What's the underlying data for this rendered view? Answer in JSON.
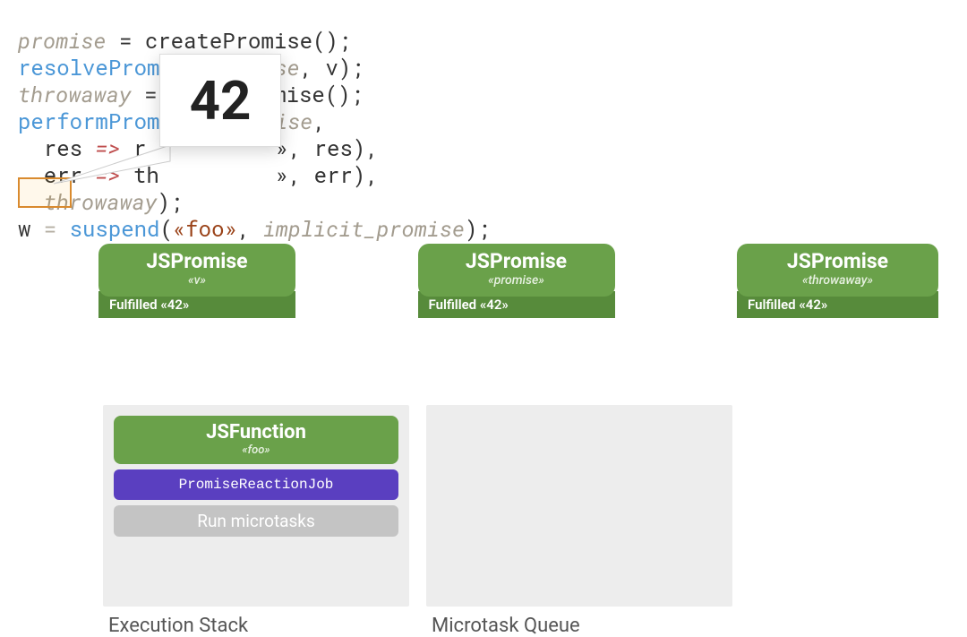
{
  "code": {
    "l1": {
      "a": "promise",
      "b": " = createPromise();"
    },
    "l2": {
      "a": "resolvePromise",
      "b": "(",
      "c": "promise",
      "d": ", v);"
    },
    "l3": {
      "a": "throwaway",
      "b": " =        omise();"
    },
    "l4": {
      "a": "performProm      ",
      "b": "romise",
      "c": ","
    },
    "l5": {
      "a": "  res ",
      "b": "=>",
      "c": " r          »",
      "d": ", res),",
      "d2": ""
    },
    "l6": {
      "a": "  err ",
      "b": "=>",
      "c": " th         »",
      "d": ", err),"
    },
    "l7": {
      "a": "  ",
      "b": "throwaway",
      "c": ");"
    },
    "l8": {
      "a": "w",
      "b": " = ",
      "c": "suspend",
      "d": "(",
      "e": "«foo»",
      "f": ", ",
      "g": "implicit_promise",
      "h": ");"
    }
  },
  "callout": {
    "value": "42"
  },
  "promises": [
    {
      "title": "JSPromise",
      "sub_l": "«",
      "sub": "v",
      "sub_r": "»",
      "status": "Fulfilled «42»"
    },
    {
      "title": "JSPromise",
      "sub_l": "«",
      "sub": "promise",
      "sub_r": "»",
      "status": "Fulfilled «42»"
    },
    {
      "title": "JSPromise",
      "sub_l": "«",
      "sub": "throwaway",
      "sub_r": "»",
      "status": "Fulfilled «42»"
    }
  ],
  "stack": {
    "jsfunc_title": "JSFunction",
    "jsfunc_sub_l": "«",
    "jsfunc_sub": "foo",
    "jsfunc_sub_r": "»",
    "prj": "PromiseReactionJob",
    "micro": "Run microtasks",
    "label": "Execution Stack"
  },
  "queue": {
    "label": "Microtask Queue"
  }
}
